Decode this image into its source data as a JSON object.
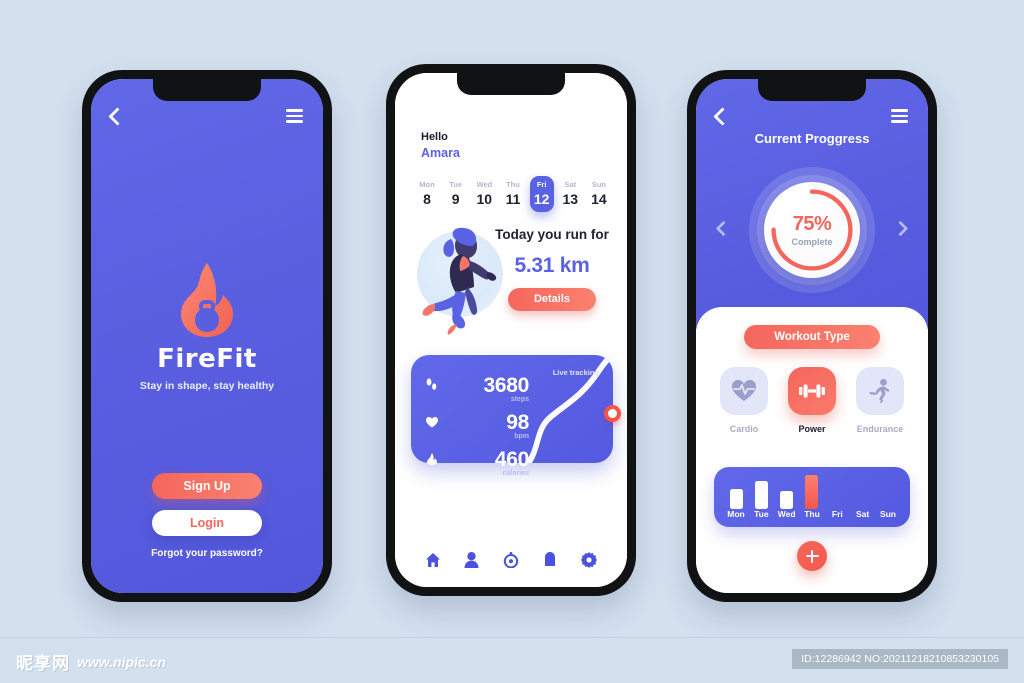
{
  "footer": {
    "watermark_cn": "昵享网",
    "watermark_url": "www.nipic.cn",
    "id_badge": "ID:12286942 NO:20211218210853230105"
  },
  "colors": {
    "page_bg": "#d3e0ee",
    "brand_blue": "#5a62e4",
    "accent_coral": "#f4665c",
    "frame_black": "#111214"
  },
  "screen1": {
    "back_icon": "chevron-left-icon",
    "menu_icon": "hamburger-icon",
    "logo_icon": "flame-kettlebell-icon",
    "brand_name": "FireFit",
    "tagline": "Stay in shape, stay healthy",
    "signup_label": "Sign Up",
    "login_label": "Login",
    "forgot_label": "Forgot your password?"
  },
  "screen2": {
    "greeting": "Hello",
    "user_name": "Amara",
    "days": [
      {
        "name": "Mon",
        "num": "8",
        "active": false
      },
      {
        "name": "Tue",
        "num": "9",
        "active": false
      },
      {
        "name": "Wed",
        "num": "10",
        "active": false
      },
      {
        "name": "Thu",
        "num": "11",
        "active": false
      },
      {
        "name": "Fri",
        "num": "12",
        "active": true
      },
      {
        "name": "Sat",
        "num": "13",
        "active": false
      },
      {
        "name": "Sun",
        "num": "14",
        "active": false
      }
    ],
    "run_title": "Today you run for",
    "run_distance": "5.31 km",
    "details_label": "Details",
    "illustration": "running-woman-illustration",
    "tracking_label": "Live tracking",
    "stats": [
      {
        "icon": "footsteps-icon",
        "value": "3680",
        "unit": "steps"
      },
      {
        "icon": "heart-icon",
        "value": "98",
        "unit": "bpm"
      },
      {
        "icon": "flame-icon",
        "value": "460",
        "unit": "calories"
      }
    ],
    "nav": [
      {
        "icon": "home-icon"
      },
      {
        "icon": "person-icon"
      },
      {
        "icon": "stopwatch-icon"
      },
      {
        "icon": "bell-icon"
      },
      {
        "icon": "gear-icon"
      }
    ]
  },
  "screen3": {
    "back_icon": "chevron-left-icon",
    "menu_icon": "hamburger-icon",
    "title": "Current Proggress",
    "progress_percent": "75%",
    "progress_sub": "Complete",
    "progress_value": 75,
    "prev_icon": "chevron-left-icon",
    "next_icon": "chevron-right-icon",
    "workout_type_label": "Workout Type",
    "workout_types": [
      {
        "label": "Cardio",
        "icon": "heart-pulse-icon",
        "selected": false
      },
      {
        "label": "Power",
        "icon": "dumbbell-icon",
        "selected": true
      },
      {
        "label": "Endurance",
        "icon": "runner-icon",
        "selected": false
      }
    ],
    "add_label": "+",
    "week_chart": {
      "type": "bar",
      "categories": [
        "Mon",
        "Tue",
        "Wed",
        "Thu",
        "Fri",
        "Sat",
        "Sun"
      ],
      "values": [
        20,
        28,
        18,
        34,
        0,
        0,
        0
      ],
      "highlight_index": 3,
      "ylim": [
        0,
        34
      ],
      "title": "",
      "xlabel": "",
      "ylabel": ""
    }
  }
}
